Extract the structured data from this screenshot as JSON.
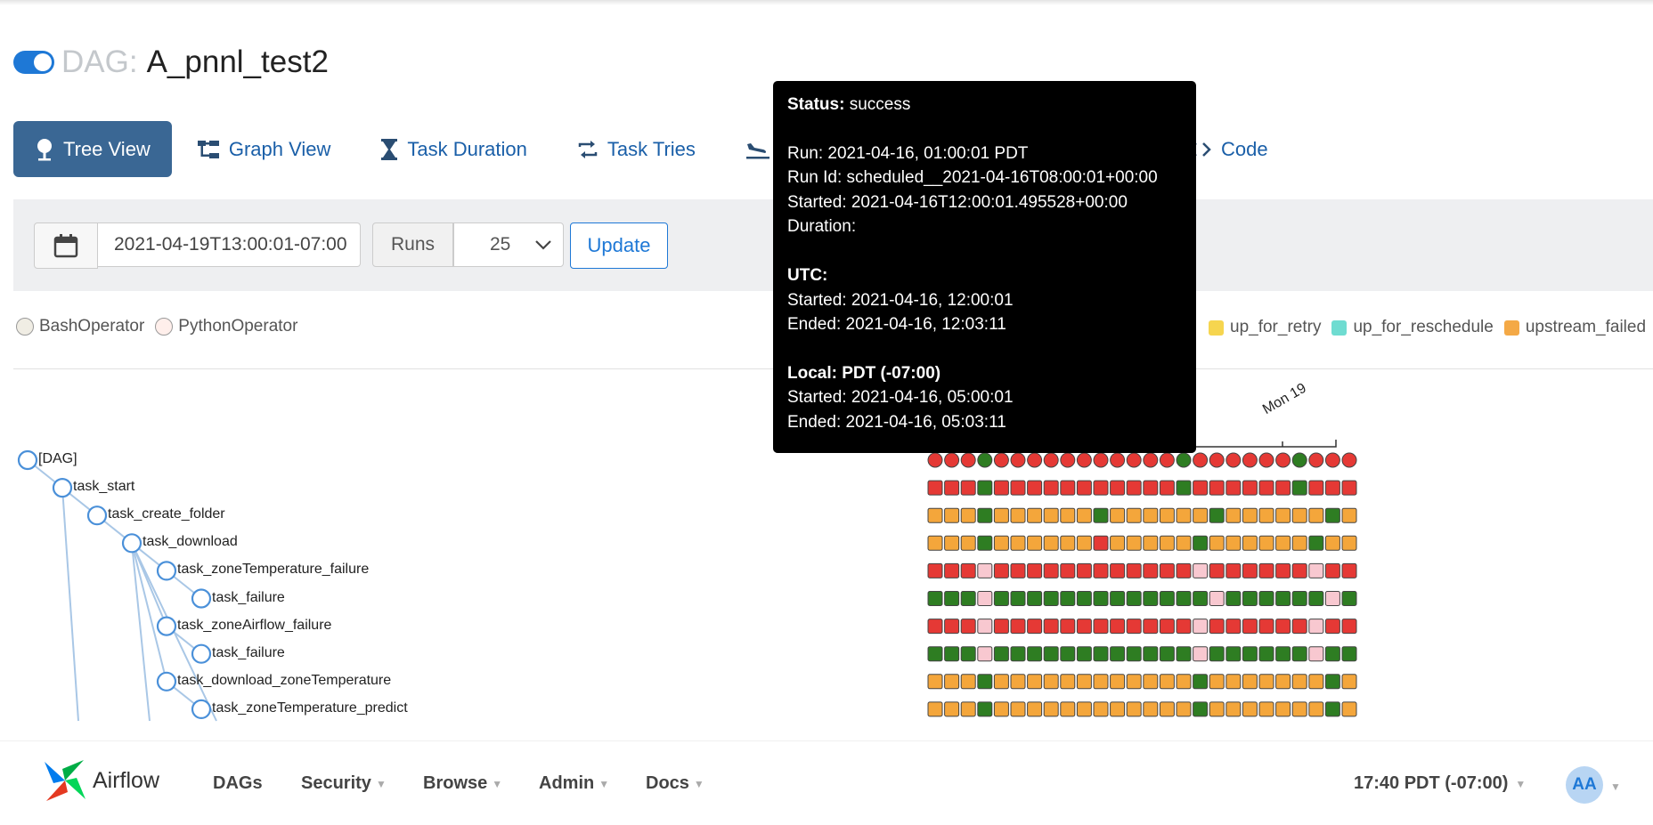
{
  "header": {
    "dag_prefix": "DAG:",
    "dag_name": "A_pnnl_test2"
  },
  "tabs": [
    {
      "label": "Tree View",
      "icon": "tree-icon",
      "active": true
    },
    {
      "label": "Graph View",
      "icon": "graph-icon",
      "active": false
    },
    {
      "label": "Task Duration",
      "icon": "hourglass-icon",
      "active": false
    },
    {
      "label": "Task Tries",
      "icon": "retry-icon",
      "active": false
    },
    {
      "label": "",
      "icon": "plane-landing-icon",
      "active": false
    },
    {
      "label": "Code",
      "icon": "code-icon",
      "active": false
    }
  ],
  "filters": {
    "base_date": "2021-04-19T13:00:01-07:00",
    "runs_label": "Runs",
    "runs_value": "25",
    "update_label": "Update"
  },
  "operators": [
    {
      "name": "BashOperator",
      "color": "#f0ede4"
    },
    {
      "name": "PythonOperator",
      "color": "#ffefeb"
    }
  ],
  "states": [
    {
      "name": "up_for_retry",
      "color": "#f6d54f"
    },
    {
      "name": "up_for_reschedule",
      "color": "#6fdcd1"
    },
    {
      "name": "upstream_failed",
      "color": "#f4a946"
    }
  ],
  "tree": {
    "nodes": [
      {
        "label": "[DAG]",
        "depth": 0
      },
      {
        "label": "task_start",
        "depth": 1
      },
      {
        "label": "task_create_folder",
        "depth": 2
      },
      {
        "label": "task_download",
        "depth": 3
      },
      {
        "label": "task_zoneTemperature_failure",
        "depth": 4
      },
      {
        "label": "task_failure",
        "depth": 5
      },
      {
        "label": "task_zoneAirflow_failure",
        "depth": 4
      },
      {
        "label": "task_failure",
        "depth": 5
      },
      {
        "label": "task_download_zoneTemperature",
        "depth": 4
      },
      {
        "label": "task_zoneTemperature_predict",
        "depth": 5
      }
    ],
    "date_label": "Mon 19",
    "state_colors": {
      "g": "#2e7d22",
      "r": "#e53935",
      "o": "#f4a63b",
      "p": "#f8c8d0"
    },
    "rows": [
      "rrrgrrrrrrrrrrrgrrrrrrgrrr",
      "rrrgrrrrrrrrrrrgrrrrrrgrrr",
      "ooogoooooogoooooogoooooogooo",
      "ooogoooooorooooogoooooogooo",
      "rrrprrrrrrrrrrrrprrrrrrprrr",
      "gggpgggggggggggggpggggggpggg",
      "rrrprrrrrrrrrrrrprrrrrrprrr",
      "gggpggggggggggggpggggggpggg",
      "ooogoooooooooooogooooooogooo",
      "ooogoooooooooooogooooooogooo"
    ]
  },
  "tooltip": {
    "status_label": "Status:",
    "status_value": "success",
    "run": "Run: 2021-04-16, 01:00:01 PDT",
    "run_id": "Run Id: scheduled__2021-04-16T08:00:01+00:00",
    "started": "Started: 2021-04-16T12:00:01.495528+00:00",
    "duration": "Duration:",
    "utc_label": "UTC:",
    "utc_started": "Started: 2021-04-16, 12:00:01",
    "utc_ended": "Ended: 2021-04-16, 12:03:11",
    "local_label": "Local: PDT (-07:00)",
    "local_started": "Started: 2021-04-16, 05:00:01",
    "local_ended": "Ended: 2021-04-16, 05:03:11"
  },
  "navbar": {
    "brand": "Airflow",
    "items": [
      "DAGs",
      "Security",
      "Browse",
      "Admin",
      "Docs"
    ],
    "clock": "17:40 PDT (-07:00)",
    "avatar": "AA"
  }
}
